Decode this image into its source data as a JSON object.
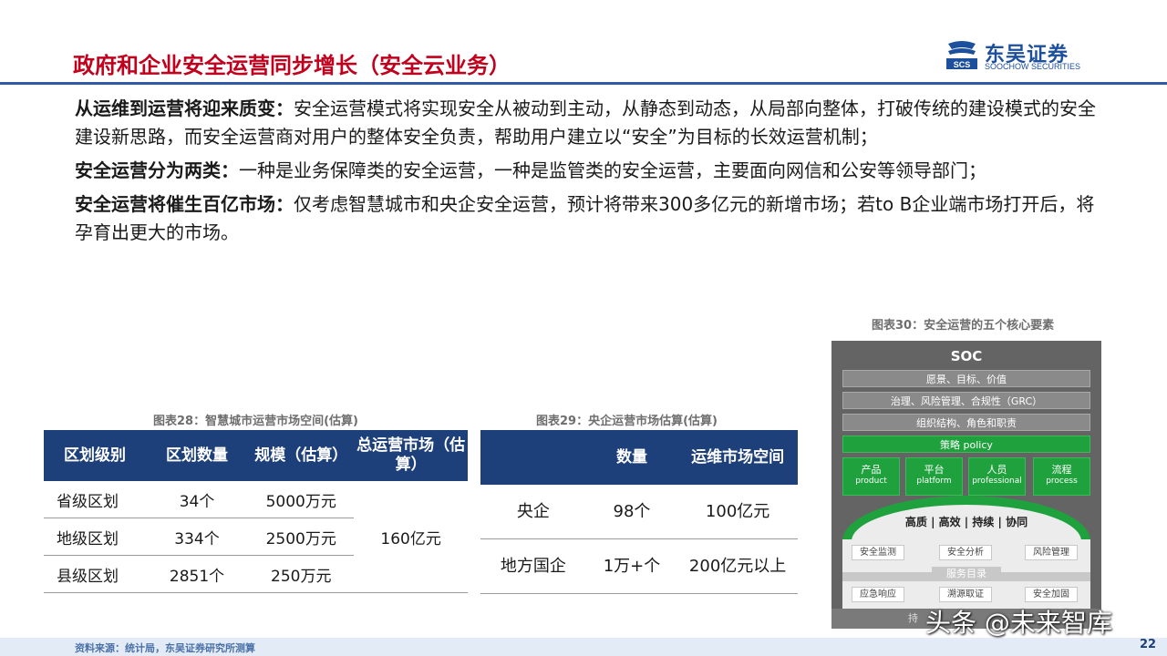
{
  "header": {
    "title": "政府和企业安全运营同步增长（安全云业务）",
    "logo_cn": "东吴证券",
    "logo_en": "SOOCHOW SECURITIES",
    "logo_mark": "SCS"
  },
  "paragraphs": [
    {
      "lead": "从运维到运营将迎来质变",
      "sep": "：",
      "text": "安全运营模式将实现安全从被动到主动，从静态到动态，从局部向整体，打破传统的建设模式的安全建设新思路，而安全运营商对用户的整体安全负责，帮助用户建立以“安全”为目标的长效运营机制；"
    },
    {
      "lead": "安全运营分为两类",
      "sep": "：",
      "text": "一种是业务保障类的安全运营，一种是监管类的安全运营，主要面向网信和公安等领导部门；"
    },
    {
      "lead": "安全运营将催生百亿市场",
      "sep": "：",
      "text": "仅考虑智慧城市和央企安全运营，预计将带来300多亿元的新增市场；若to B企业端市场打开后，将孕育出更大的市场。"
    }
  ],
  "table28": {
    "caption": "图表28：智慧城市运营市场空间(估算)",
    "headers": [
      "区划级别",
      "区划数量",
      "规模（估算）",
      "总运营市场（估算）"
    ],
    "rows": [
      [
        "省级区划",
        "34个",
        "5000万元"
      ],
      [
        "地级区划",
        "334个",
        "2500万元"
      ],
      [
        "县级区划",
        "2851个",
        "250万元"
      ]
    ],
    "merged_total": "160亿元"
  },
  "table29": {
    "caption": "图表29：央企运营市场估算(估算)",
    "headers": [
      "",
      "数量",
      "运维市场空间"
    ],
    "rows": [
      [
        "央企",
        "98个",
        "100亿元"
      ],
      [
        "地方国企",
        "1万+个",
        "200亿元以上"
      ]
    ]
  },
  "figure30": {
    "caption": "图表30：安全运营的五个核心要素",
    "title": "SOC",
    "bars": [
      "愿景、目标、价值",
      "治理、风险管理、合规性（GRC）",
      "组织结构、角色和职责",
      "策略 policy"
    ],
    "pillars": [
      {
        "cn": "产品",
        "en": "product"
      },
      {
        "cn": "平台",
        "en": "platform"
      },
      {
        "cn": "人员",
        "en": "professional"
      },
      {
        "cn": "流程",
        "en": "process"
      }
    ],
    "qualities": "高质 | 高效 | 持续 | 协同",
    "services_top": [
      "安全监测",
      "安全分析",
      "风险管理"
    ],
    "service_catalog": "服务目录",
    "services_bottom": [
      "应急响应",
      "溯源取证",
      "安全加固"
    ],
    "bottom_bar": "持"
  },
  "footer": {
    "source": "资料来源：统计局，东吴证券研究所测算",
    "page": "22",
    "watermark": "头条 @未来智库"
  }
}
